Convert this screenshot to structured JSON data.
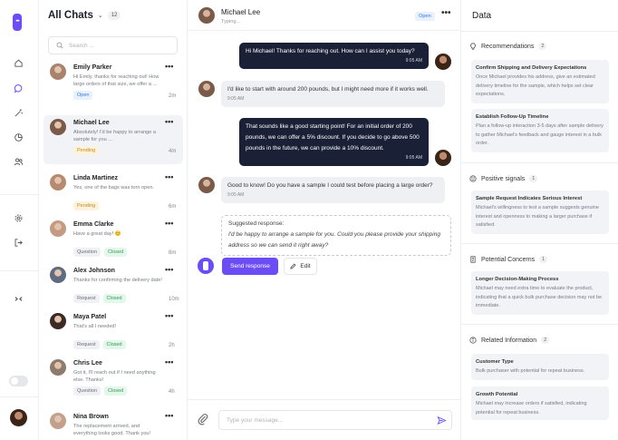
{
  "app": {
    "logo_text": "•••"
  },
  "list": {
    "title": "All Chats",
    "count": "12",
    "search_placeholder": "Search ...",
    "chats": [
      {
        "name": "Emily Parker",
        "message": "Hi Emily, thanks for reaching out! How large orders of that size, we offer a ...",
        "tags": [
          {
            "label": "Open",
            "kind": "open"
          }
        ],
        "time": "2m",
        "active": false,
        "avatar_color": "#a9826b"
      },
      {
        "name": "Michael Lee",
        "message": "Absolutely! I'd be happy to arrange a sample for you ...",
        "tags": [
          {
            "label": "Pending",
            "kind": "pending"
          }
        ],
        "time": "4m",
        "active": true,
        "avatar_color": "#7a5a48"
      },
      {
        "name": "Linda Martinez",
        "message": "Yes, one of the bags was torn open.",
        "tags": [
          {
            "label": "Pending",
            "kind": "pending"
          }
        ],
        "time": "6m",
        "active": false,
        "avatar_color": "#b58a70"
      },
      {
        "name": "Emma Clarke",
        "message": "Have a great day! 😊",
        "tags": [
          {
            "label": "Question",
            "kind": "request"
          },
          {
            "label": "Closed",
            "kind": "closed"
          }
        ],
        "time": "8m",
        "active": false,
        "avatar_color": "#c49a82"
      },
      {
        "name": "Alex Johnson",
        "message": "Thanks for confirming the delivery date!",
        "tags": [
          {
            "label": "Request",
            "kind": "request"
          },
          {
            "label": "Closed",
            "kind": "closed"
          }
        ],
        "time": "10m",
        "active": false,
        "avatar_color": "#5f6b80"
      },
      {
        "name": "Maya Patel",
        "message": "That's all I needed!",
        "tags": [
          {
            "label": "Request",
            "kind": "request"
          },
          {
            "label": "Closed",
            "kind": "closed"
          }
        ],
        "time": "2h",
        "active": false,
        "avatar_color": "#3c2a24"
      },
      {
        "name": "Chris Lee",
        "message": "Got it, I'll reach out if I need anything else. Thanks!",
        "tags": [
          {
            "label": "Question",
            "kind": "request"
          },
          {
            "label": "Closed",
            "kind": "closed"
          }
        ],
        "time": "4h",
        "active": false,
        "avatar_color": "#8d7b6c"
      },
      {
        "name": "Nina Brown",
        "message": "The replacement arrived, and everything looks good. Thank you!",
        "tags": [],
        "time": "",
        "active": false,
        "avatar_color": "#c3a08c"
      }
    ]
  },
  "conversation": {
    "contact_name": "Michael Lee",
    "contact_status": "Typing...",
    "status_badge": "Open",
    "messages": [
      {
        "dir": "out",
        "text": "Hi Michael! Thanks for reaching out. How can I assist you today?",
        "time": "9:05 AM"
      },
      {
        "dir": "in",
        "text": "I'd like to start with around 200 pounds, but I might need more if it works well.",
        "time": "9:05 AM"
      },
      {
        "dir": "out",
        "text": "That sounds like a good starting point! For an initial order of 200 pounds, we can offer a 5% discount. If you decide to go above 500 pounds in the future, we can provide a 10% discount.",
        "time": "9:05 AM"
      },
      {
        "dir": "in",
        "text": "Good to know! Do you have a sample I could test before placing a large order?",
        "time": "9:05 AM"
      }
    ],
    "suggested_label": "Suggested response:",
    "suggested_text": "I'd be happy to arrange a sample for you. Could you please provide your shipping address so we can send it right away?",
    "send_label": "Send response",
    "edit_label": "Edit",
    "composer_placeholder": "Type your message..."
  },
  "insights": {
    "title": "Data",
    "sections": [
      {
        "title": "Recommendations",
        "count": "2",
        "icon": "lightbulb-icon",
        "cards": [
          {
            "title": "Confirm Shipping and Delivery Expectations",
            "body": "Once Michael provides his address, give an estimated delivery timeline for the sample, which helps set clear expectations."
          },
          {
            "title": "Establish Follow-Up Timeline",
            "body": "Plan a follow-up interaction 3-5 days after sample delivery to gather Michael's feedback and gauge interest in a bulk order."
          }
        ]
      },
      {
        "title": "Positive signals",
        "count": "1",
        "icon": "smile-icon",
        "cards": [
          {
            "title": "Sample Request Indicates Serious Interest",
            "body": "Michael's willingness to test a sample suggests genuine interest and openness to making a larger purchase if satisfied."
          }
        ]
      },
      {
        "title": "Potential Concerns",
        "count": "1",
        "icon": "document-icon",
        "cards": [
          {
            "title": "Longer Decision-Making Process",
            "body": "Michael may need extra time to evaluate the product, indicating that a quick bulk purchase decision may not be immediate."
          }
        ]
      },
      {
        "title": "Related Information",
        "count": "2",
        "icon": "info-icon",
        "cards": [
          {
            "title": "Customer Type",
            "body": "Bulk purchaser with potential for repeat business."
          },
          {
            "title": "Growth Potential",
            "body": "Michael may increase orders if satisfied, indicating potential for repeat business."
          }
        ]
      }
    ]
  },
  "colors": {
    "accent": "#6c4df5",
    "dark_bubble": "#1a2036",
    "open": "#3a78d8",
    "pending": "#c7881c",
    "closed": "#2f9c58"
  }
}
